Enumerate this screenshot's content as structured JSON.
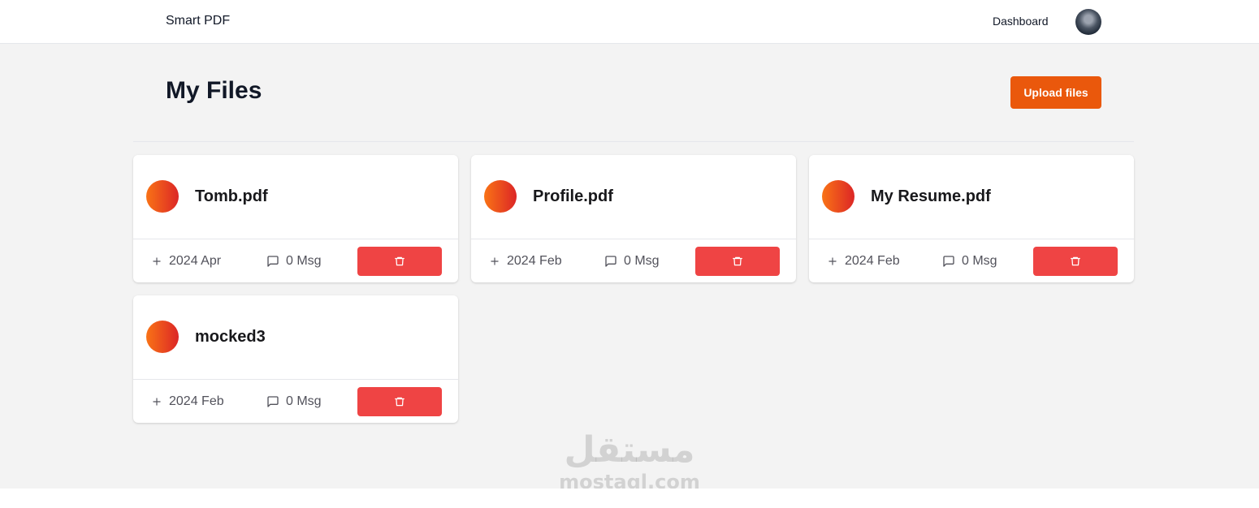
{
  "header": {
    "brand": "Smart PDF",
    "nav_dashboard": "Dashboard",
    "avatar_icon": "user-avatar"
  },
  "main": {
    "title": "My Files",
    "upload_button": "Upload files"
  },
  "files": [
    {
      "name": "Tomb.pdf",
      "date": "2024 Apr",
      "messages": "0 Msg"
    },
    {
      "name": "Profile.pdf",
      "date": "2024 Feb",
      "messages": "0 Msg"
    },
    {
      "name": "My Resume.pdf",
      "date": "2024 Feb",
      "messages": "0 Msg"
    },
    {
      "name": "mocked3",
      "date": "2024 Feb",
      "messages": "0 Msg"
    }
  ],
  "icons": {
    "date": "plus-icon",
    "messages": "message-square-icon",
    "delete": "trash-icon"
  },
  "watermark": {
    "arabic": "مستقل",
    "latin": "mostaql.com"
  },
  "colors": {
    "accent": "#ea580c",
    "delete": "#ef4444",
    "gradient_start": "#f97316",
    "gradient_end": "#dc2626",
    "background": "#f3f3f3"
  }
}
